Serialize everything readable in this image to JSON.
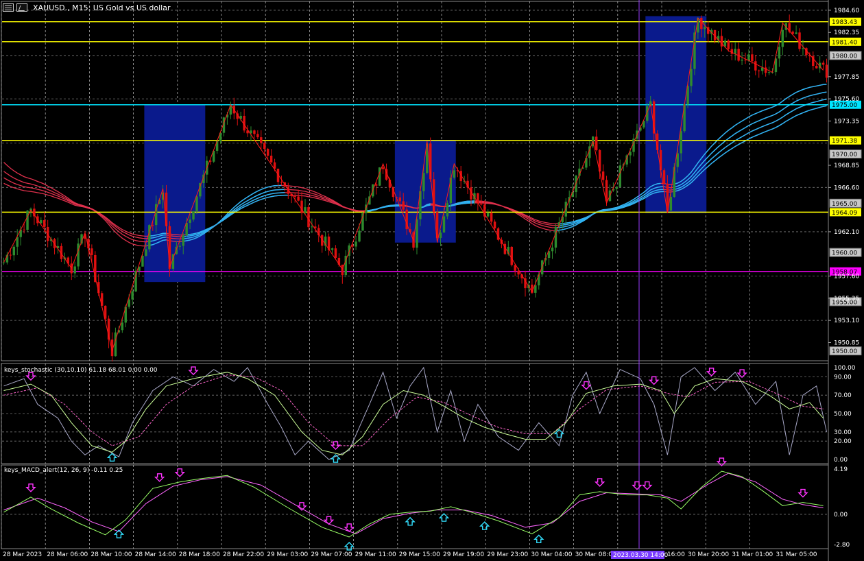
{
  "window": {
    "title": "XAUUSD., M15:  US Gold vs US dollar",
    "icons": [
      "chart-list-icon",
      "chart-type-icon"
    ]
  },
  "colors": {
    "background": "#000000",
    "bull": "#2e8b2e",
    "bear": "#e01010",
    "yellow_line": "#ffff00",
    "cyan_line": "#00e5ff",
    "magenta_line": "#ff00ff",
    "box": "#0a1a8c",
    "ema_cyan": "#29b6f6",
    "ema_red": "#e0304c",
    "zigzag": "#ff1a1a",
    "stoch_main": "#ccff99",
    "stoch_signal": "#ff66cc",
    "stoch_raw": "#a9a9c9",
    "macd_line": "#99ff66",
    "macd_signal": "#ff66ff",
    "arrow_down": "#ff33ff",
    "arrow_up": "#33e0ff"
  },
  "chart_data": [
    {
      "type": "candlestick",
      "symbol": "XAUUSD.",
      "timeframe": "M15",
      "ylim": [
        1949.0,
        1985.5
      ],
      "y_ticks": [
        "1984.60",
        "1982.35",
        "1977.85",
        "1975.60",
        "1973.35",
        "1968.85",
        "1966.60",
        "1962.10",
        "1957.60",
        "1955.35",
        "1953.10",
        "1950.85"
      ],
      "x_ticks": [
        "28 Mar 2023",
        "28 Mar 06:00",
        "28 Mar 10:00",
        "28 Mar 14:00",
        "28 Mar 18:00",
        "28 Mar 22:00",
        "29 Mar 03:00",
        "29 Mar 07:00",
        "29 Mar 11:00",
        "29 Mar 15:00",
        "29 Mar 19:00",
        "29 Mar 23:00",
        "30 Mar 04:00",
        "30 Mar 08:00",
        "30 Mar 16:00",
        "30 Mar 20:00",
        "31 Mar 01:00",
        "31 Mar 05:00"
      ],
      "crosshair_time": "2023.03.30 14:00",
      "level_lines": [
        {
          "price": 1983.43,
          "label": "1983.43",
          "color": "yellow"
        },
        {
          "price": 1981.4,
          "label": "1981.40",
          "color": "yellow"
        },
        {
          "price": 1980.0,
          "label": "1980.00",
          "color": "gray"
        },
        {
          "price": 1975.0,
          "label": "1975.00",
          "color": "cyan"
        },
        {
          "price": 1971.38,
          "label": "1971.38",
          "color": "yellow"
        },
        {
          "price": 1970.0,
          "label": "1970.00",
          "color": "gray"
        },
        {
          "price": 1965.0,
          "label": "1965.00",
          "color": "gray"
        },
        {
          "price": 1964.09,
          "label": "1964.09",
          "color": "yellow"
        },
        {
          "price": 1960.0,
          "label": "1960.00",
          "color": "gray"
        },
        {
          "price": 1958.07,
          "label": "1958.07",
          "color": "magenta"
        },
        {
          "price": 1955.0,
          "label": "1955.00",
          "color": "gray"
        },
        {
          "price": 1950.0,
          "label": "1950.00",
          "color": "gray"
        }
      ],
      "boxes": [
        {
          "from_bar": 42,
          "to_bar": 60,
          "high": 1975.0,
          "low": 1957.0
        },
        {
          "from_bar": 116,
          "to_bar": 134,
          "high": 1971.4,
          "low": 1961.0
        },
        {
          "from_bar": 190,
          "to_bar": 208,
          "high": 1984.0,
          "low": 1964.0
        }
      ],
      "zigzag": [
        [
          0,
          1959.0
        ],
        [
          8,
          1964.3
        ],
        [
          20,
          1958.4
        ],
        [
          24,
          1962.0
        ],
        [
          32,
          1950.0
        ],
        [
          47,
          1966.5
        ],
        [
          49,
          1958.5
        ],
        [
          67,
          1975.0
        ],
        [
          100,
          1958.3
        ],
        [
          112,
          1969.0
        ],
        [
          121,
          1961.2
        ],
        [
          125,
          1971.3
        ],
        [
          128,
          1961.0
        ],
        [
          133,
          1969.0
        ],
        [
          156,
          1956.0
        ],
        [
          174,
          1971.3
        ],
        [
          178,
          1965.0
        ],
        [
          191,
          1975.0
        ],
        [
          196,
          1964.0
        ],
        [
          205,
          1983.8
        ],
        [
          214,
          1980.5
        ],
        [
          227,
          1978.3
        ],
        [
          230,
          1983.3
        ],
        [
          242,
          1978.5
        ]
      ]
    },
    {
      "type": "line",
      "name": "keys_stochastic (30,10,10) 61.18 68.01 0.00 0.00",
      "ylim": [
        0,
        100
      ],
      "y_ticks": [
        "100.00",
        "90.00",
        "70.00",
        "50.00",
        "30.00",
        "20.00",
        "0.00"
      ],
      "main": [
        [
          0,
          75
        ],
        [
          8,
          82
        ],
        [
          14,
          70
        ],
        [
          20,
          40
        ],
        [
          26,
          15
        ],
        [
          32,
          8
        ],
        [
          36,
          20
        ],
        [
          42,
          55
        ],
        [
          48,
          80
        ],
        [
          56,
          88
        ],
        [
          66,
          95
        ],
        [
          72,
          88
        ],
        [
          80,
          70
        ],
        [
          88,
          30
        ],
        [
          94,
          10
        ],
        [
          100,
          5
        ],
        [
          106,
          25
        ],
        [
          112,
          60
        ],
        [
          118,
          75
        ],
        [
          124,
          70
        ],
        [
          130,
          58
        ],
        [
          136,
          45
        ],
        [
          142,
          35
        ],
        [
          148,
          28
        ],
        [
          154,
          22
        ],
        [
          160,
          22
        ],
        [
          166,
          40
        ],
        [
          172,
          72
        ],
        [
          180,
          80
        ],
        [
          188,
          82
        ],
        [
          194,
          75
        ],
        [
          198,
          50
        ],
        [
          204,
          80
        ],
        [
          210,
          88
        ],
        [
          218,
          85
        ],
        [
          226,
          70
        ],
        [
          232,
          55
        ],
        [
          238,
          62
        ],
        [
          242,
          45
        ]
      ],
      "signal": [
        [
          0,
          70
        ],
        [
          10,
          78
        ],
        [
          18,
          60
        ],
        [
          26,
          30
        ],
        [
          32,
          15
        ],
        [
          40,
          25
        ],
        [
          48,
          60
        ],
        [
          56,
          80
        ],
        [
          66,
          92
        ],
        [
          74,
          90
        ],
        [
          82,
          75
        ],
        [
          90,
          40
        ],
        [
          98,
          15
        ],
        [
          106,
          15
        ],
        [
          114,
          45
        ],
        [
          122,
          68
        ],
        [
          130,
          62
        ],
        [
          138,
          48
        ],
        [
          146,
          35
        ],
        [
          154,
          28
        ],
        [
          162,
          28
        ],
        [
          170,
          55
        ],
        [
          178,
          76
        ],
        [
          188,
          80
        ],
        [
          196,
          72
        ],
        [
          202,
          68
        ],
        [
          210,
          84
        ],
        [
          220,
          85
        ],
        [
          228,
          72
        ],
        [
          236,
          58
        ],
        [
          242,
          55
        ]
      ],
      "raw": [
        [
          0,
          80
        ],
        [
          6,
          88
        ],
        [
          10,
          60
        ],
        [
          16,
          45
        ],
        [
          20,
          20
        ],
        [
          24,
          5
        ],
        [
          28,
          15
        ],
        [
          34,
          3
        ],
        [
          38,
          40
        ],
        [
          44,
          75
        ],
        [
          50,
          90
        ],
        [
          56,
          80
        ],
        [
          62,
          98
        ],
        [
          68,
          85
        ],
        [
          72,
          100
        ],
        [
          78,
          60
        ],
        [
          82,
          35
        ],
        [
          86,
          5
        ],
        [
          90,
          20
        ],
        [
          96,
          0
        ],
        [
          102,
          10
        ],
        [
          108,
          60
        ],
        [
          112,
          95
        ],
        [
          116,
          45
        ],
        [
          120,
          80
        ],
        [
          124,
          100
        ],
        [
          128,
          30
        ],
        [
          132,
          75
        ],
        [
          136,
          20
        ],
        [
          140,
          60
        ],
        [
          146,
          25
        ],
        [
          152,
          10
        ],
        [
          158,
          40
        ],
        [
          164,
          15
        ],
        [
          168,
          70
        ],
        [
          172,
          95
        ],
        [
          176,
          50
        ],
        [
          182,
          98
        ],
        [
          188,
          88
        ],
        [
          192,
          60
        ],
        [
          196,
          5
        ],
        [
          200,
          90
        ],
        [
          204,
          100
        ],
        [
          210,
          75
        ],
        [
          216,
          95
        ],
        [
          222,
          60
        ],
        [
          228,
          85
        ],
        [
          232,
          5
        ],
        [
          236,
          70
        ],
        [
          240,
          80
        ],
        [
          243,
          30
        ]
      ],
      "down_arrows": [
        8,
        56,
        98,
        172,
        192,
        209,
        218
      ],
      "up_arrows": [
        32,
        98,
        164
      ]
    },
    {
      "type": "line",
      "name": "keys_MACD_alert(12, 26, 9) -0.11 0.25",
      "ylim": [
        -2.8,
        4.19
      ],
      "y_ticks": [
        "4.19",
        "0.00",
        "-2.80"
      ],
      "macd": [
        [
          0,
          0.2
        ],
        [
          8,
          1.6
        ],
        [
          14,
          0.5
        ],
        [
          22,
          -0.8
        ],
        [
          30,
          -1.9
        ],
        [
          36,
          -0.5
        ],
        [
          44,
          2.4
        ],
        [
          52,
          3.0
        ],
        [
          58,
          3.3
        ],
        [
          66,
          3.6
        ],
        [
          74,
          2.5
        ],
        [
          84,
          0.6
        ],
        [
          94,
          -1.2
        ],
        [
          102,
          -2.1
        ],
        [
          108,
          -0.9
        ],
        [
          114,
          0.0
        ],
        [
          120,
          0.2
        ],
        [
          126,
          0.3
        ],
        [
          132,
          0.7
        ],
        [
          138,
          0.2
        ],
        [
          146,
          -0.6
        ],
        [
          156,
          -1.8
        ],
        [
          164,
          -0.3
        ],
        [
          170,
          1.8
        ],
        [
          176,
          2.1
        ],
        [
          184,
          1.8
        ],
        [
          190,
          1.8
        ],
        [
          196,
          1.5
        ],
        [
          200,
          0.5
        ],
        [
          206,
          2.5
        ],
        [
          212,
          4.0
        ],
        [
          218,
          3.5
        ],
        [
          224,
          2.2
        ],
        [
          230,
          0.8
        ],
        [
          236,
          1.1
        ],
        [
          242,
          0.8
        ]
      ],
      "signal": [
        [
          0,
          0.4
        ],
        [
          10,
          1.5
        ],
        [
          18,
          0.6
        ],
        [
          26,
          -0.7
        ],
        [
          34,
          -1.6
        ],
        [
          42,
          1.0
        ],
        [
          50,
          2.6
        ],
        [
          58,
          3.2
        ],
        [
          66,
          3.5
        ],
        [
          76,
          2.7
        ],
        [
          86,
          0.9
        ],
        [
          96,
          -0.9
        ],
        [
          104,
          -1.8
        ],
        [
          112,
          -0.4
        ],
        [
          120,
          0.1
        ],
        [
          128,
          0.4
        ],
        [
          136,
          0.4
        ],
        [
          144,
          -0.1
        ],
        [
          154,
          -1.2
        ],
        [
          162,
          -0.8
        ],
        [
          170,
          1.2
        ],
        [
          178,
          2.0
        ],
        [
          186,
          1.9
        ],
        [
          194,
          1.8
        ],
        [
          200,
          1.2
        ],
        [
          208,
          2.8
        ],
        [
          214,
          3.8
        ],
        [
          222,
          3.0
        ],
        [
          230,
          1.4
        ],
        [
          236,
          0.9
        ],
        [
          242,
          0.6
        ]
      ],
      "down_arrows": [
        8,
        46,
        52,
        88,
        96,
        102,
        176,
        187,
        190,
        212,
        236
      ],
      "up_arrows": [
        34,
        102,
        120,
        130,
        142,
        158
      ]
    }
  ]
}
